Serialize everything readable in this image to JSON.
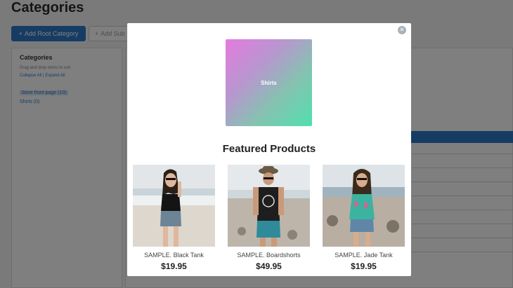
{
  "page": {
    "title": "Categories",
    "add_root_label": "Add Root Category",
    "add_sub_label": "Add Sub",
    "sidebar": {
      "title": "Categories",
      "hint": "Drag and drop items to sort",
      "collapse_label": "Collapse All",
      "expand_label": "Expand All",
      "tree": [
        "Store front page (10)",
        "Shirts (0)"
      ]
    }
  },
  "modal": {
    "banner_label": "Shirts",
    "heading": "Featured Products",
    "products": [
      {
        "name": "SAMPLE. Black Tank",
        "price": "$19.95"
      },
      {
        "name": "SAMPLE. Boardshorts",
        "price": "$49.95"
      },
      {
        "name": "SAMPLE. Jade Tank",
        "price": "$19.95"
      }
    ]
  },
  "colors": {
    "accent": "#2e79c9",
    "overlay": "rgba(0,0,0,0.5)",
    "banner_gradient": [
      "#e47bde",
      "#50e0ae"
    ]
  },
  "icons": {
    "close": "close-icon",
    "add": "plus-icon"
  }
}
